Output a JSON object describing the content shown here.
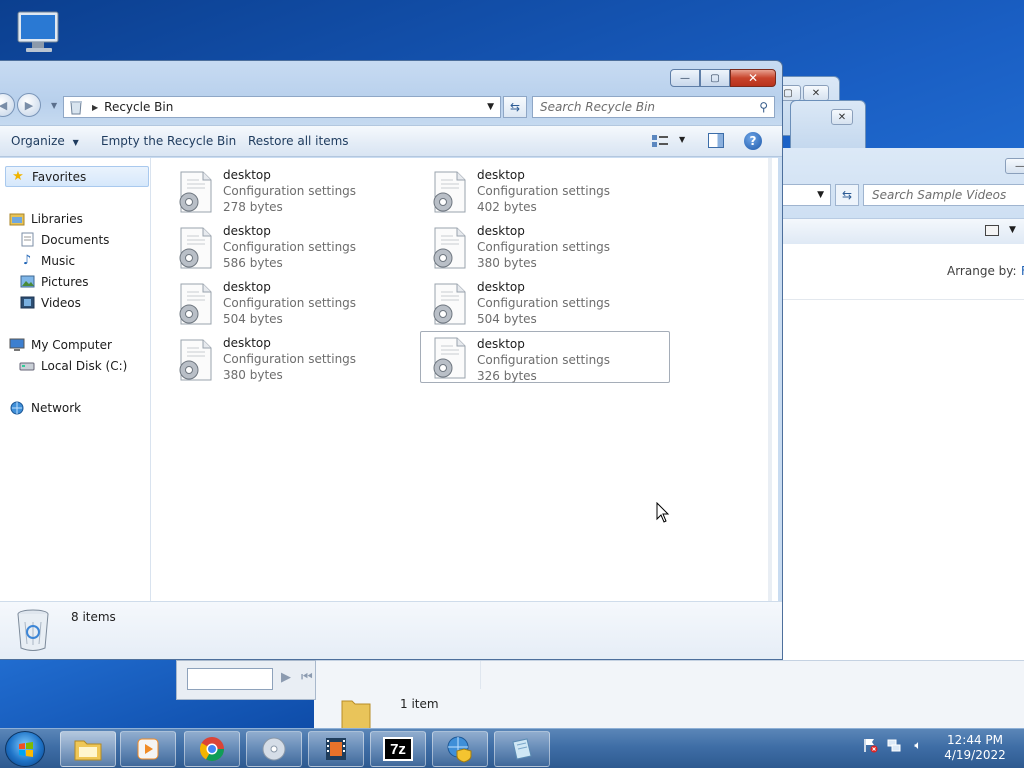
{
  "window": {
    "title": "Recycle Bin",
    "controls": {
      "minimize": "—",
      "maximize": "▢",
      "close": "✕"
    }
  },
  "address": {
    "location": "Recycle Bin"
  },
  "search": {
    "placeholder": "Search Recycle Bin"
  },
  "toolbar": {
    "organize": "Organize",
    "empty": "Empty the Recycle Bin",
    "restore": "Restore all items"
  },
  "sidebar": {
    "favorites": "Favorites",
    "libraries": "Libraries",
    "documents": "Documents",
    "music": "Music",
    "pictures": "Pictures",
    "videos": "Videos",
    "computer": "My Computer",
    "local_disk": "Local Disk (C:)",
    "network": "Network"
  },
  "files": [
    {
      "name": "desktop",
      "type": "Configuration settings",
      "size": "278 bytes"
    },
    {
      "name": "desktop",
      "type": "Configuration settings",
      "size": "402 bytes"
    },
    {
      "name": "desktop",
      "type": "Configuration settings",
      "size": "586 bytes"
    },
    {
      "name": "desktop",
      "type": "Configuration settings",
      "size": "380 bytes"
    },
    {
      "name": "desktop",
      "type": "Configuration settings",
      "size": "504 bytes"
    },
    {
      "name": "desktop",
      "type": "Configuration settings",
      "size": "504 bytes"
    },
    {
      "name": "desktop",
      "type": "Configuration settings",
      "size": "380 bytes"
    },
    {
      "name": "desktop",
      "type": "Configuration settings",
      "size": "326 bytes"
    }
  ],
  "details": {
    "count": "8 items"
  },
  "bg_videos_window": {
    "search_placeholder": "Search Sample Videos",
    "arrange_label": "Arrange by:",
    "arrange_value": "F",
    "status": "1 item"
  },
  "taskbar": {
    "apps": [
      "windows-explorer",
      "media-player",
      "chrome",
      "dvd-maker",
      "movie-maker",
      "7zip",
      "security-center",
      "notepad"
    ],
    "tray": {
      "time": "12:44 PM",
      "date": "4/19/2022"
    }
  }
}
